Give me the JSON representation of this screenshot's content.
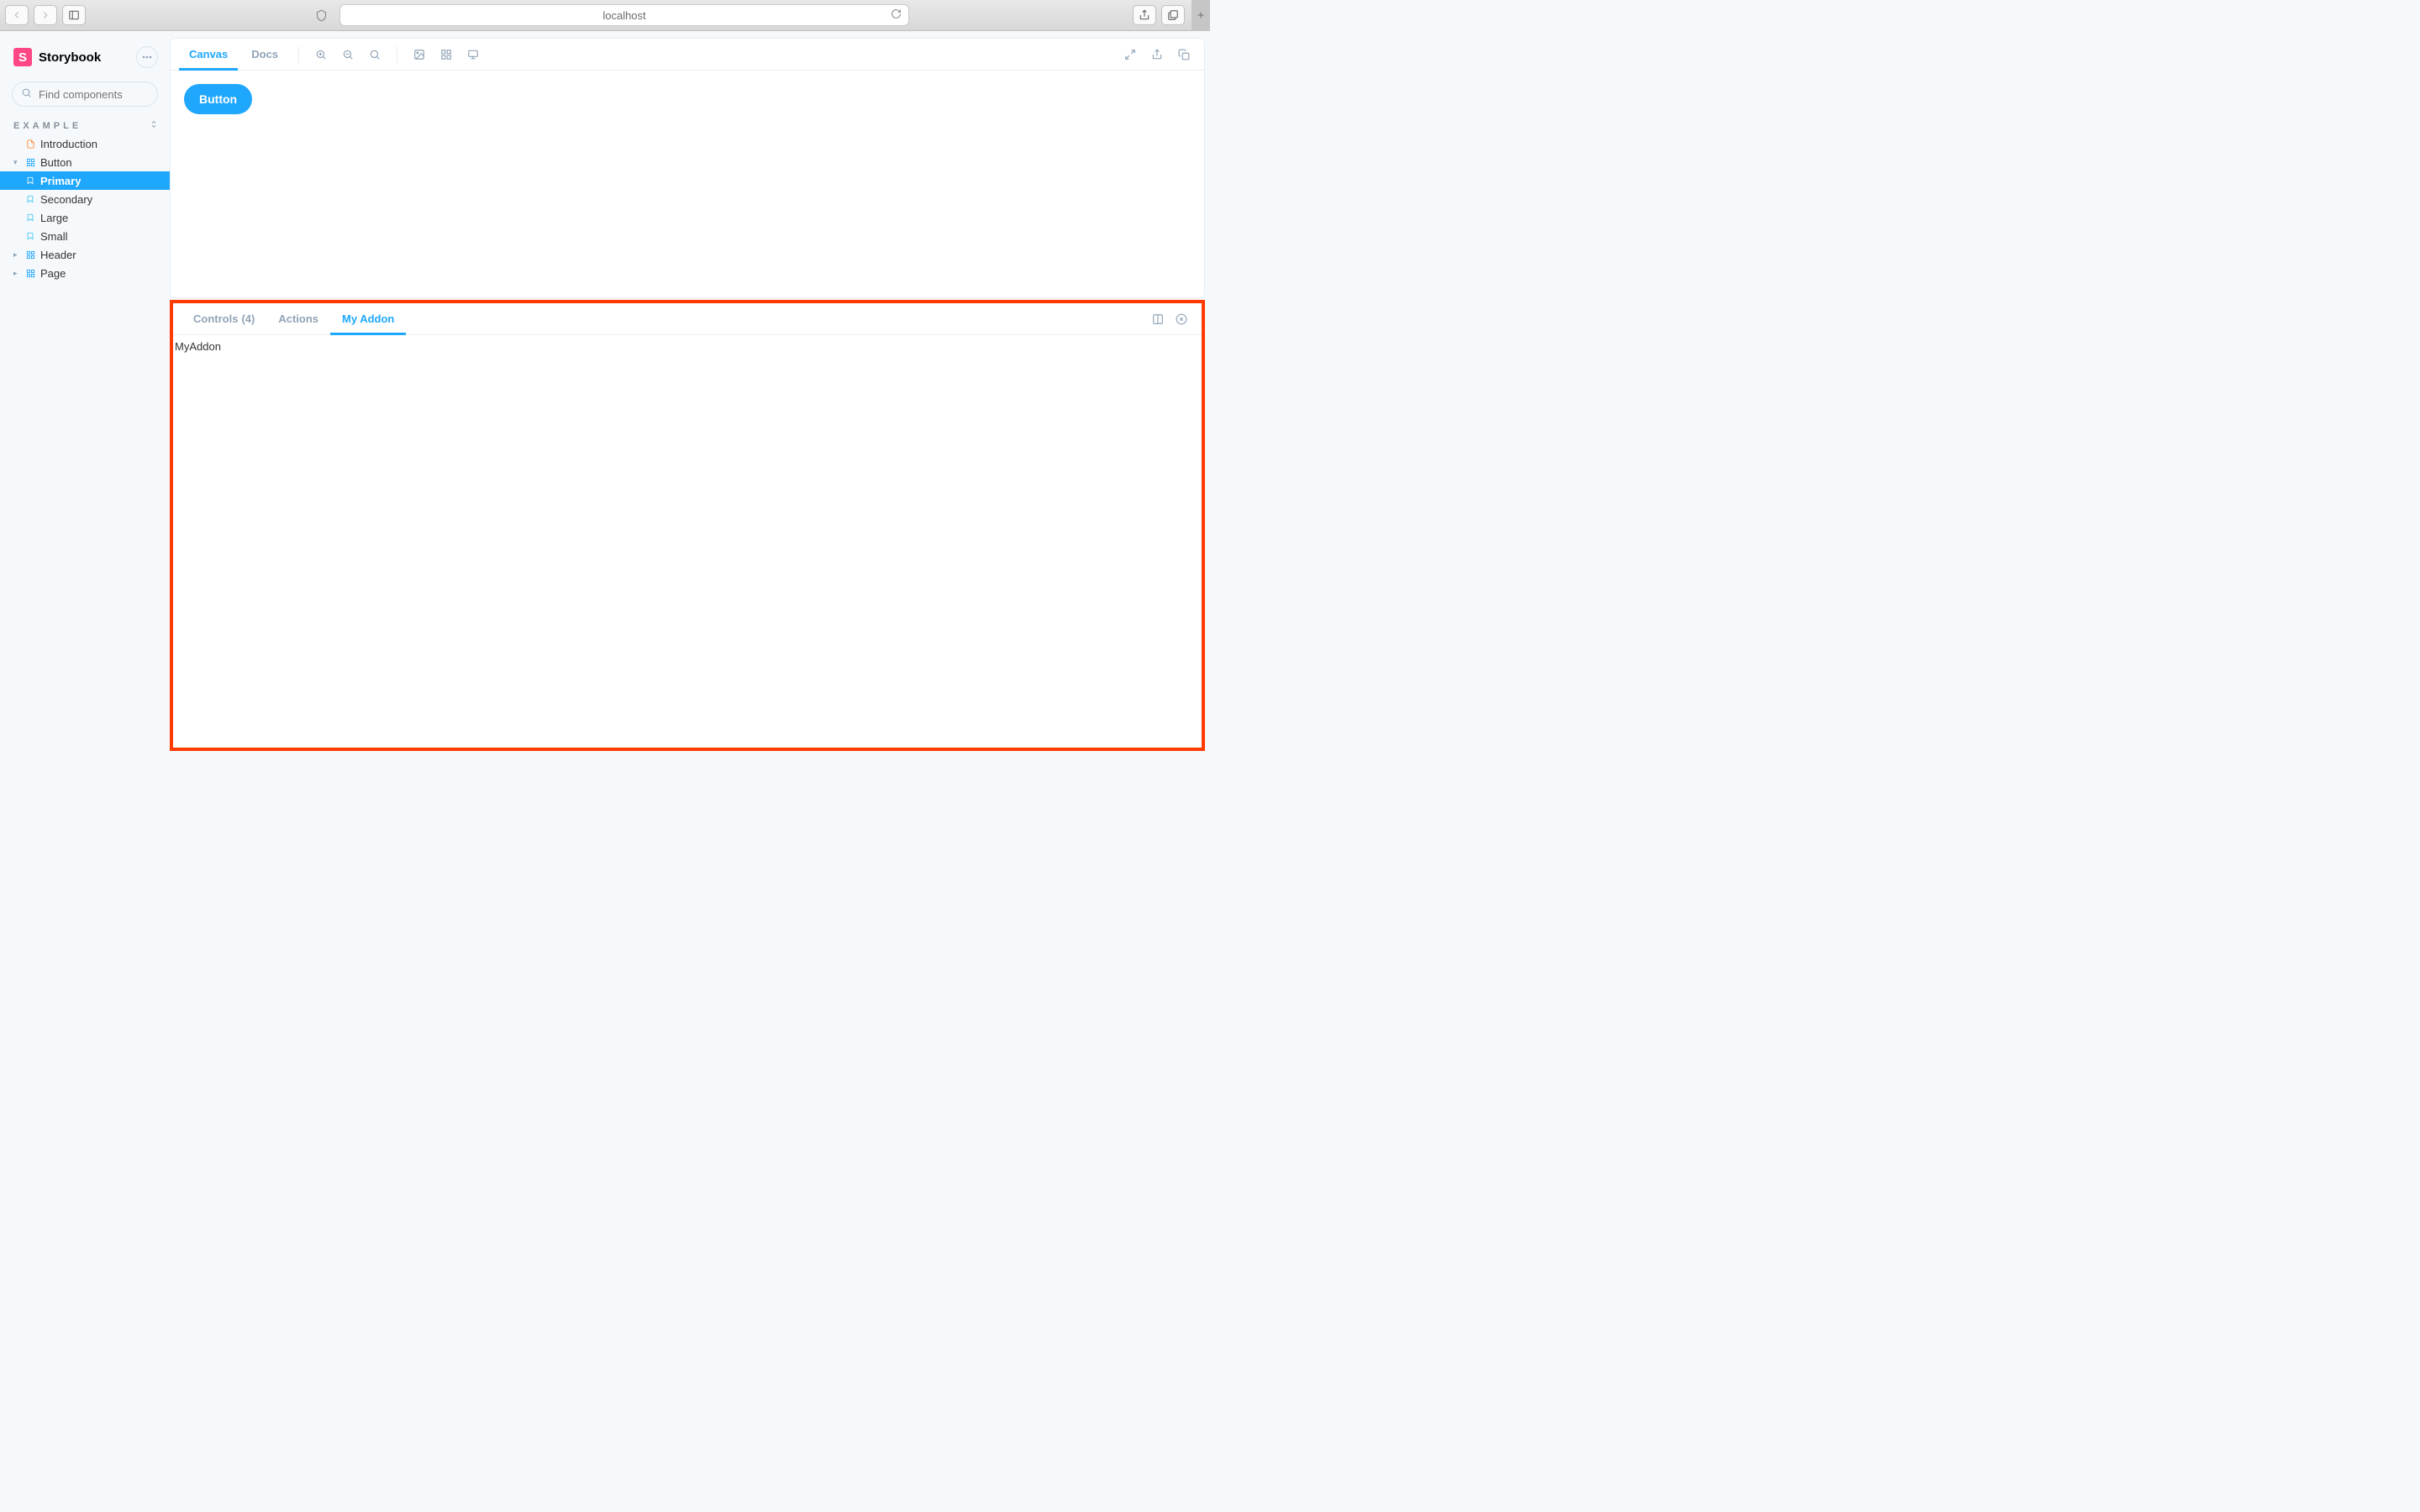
{
  "browser": {
    "url": "localhost"
  },
  "sidebar": {
    "app_name": "Storybook",
    "search_placeholder": "Find components",
    "search_key": "/",
    "section_label": "Example",
    "items": [
      {
        "label": "Introduction",
        "kind": "doc"
      },
      {
        "label": "Button",
        "kind": "component",
        "expanded": true,
        "children": [
          {
            "label": "Primary",
            "active": true
          },
          {
            "label": "Secondary"
          },
          {
            "label": "Large"
          },
          {
            "label": "Small"
          }
        ]
      },
      {
        "label": "Header",
        "kind": "component"
      },
      {
        "label": "Page",
        "kind": "component"
      }
    ]
  },
  "preview": {
    "tabs": {
      "canvas": "Canvas",
      "docs": "Docs"
    },
    "button_label": "Button"
  },
  "panel": {
    "tabs": {
      "controls_label": "Controls",
      "controls_count": "(4)",
      "actions": "Actions",
      "myaddon": "My Addon"
    },
    "content": "MyAddon"
  }
}
